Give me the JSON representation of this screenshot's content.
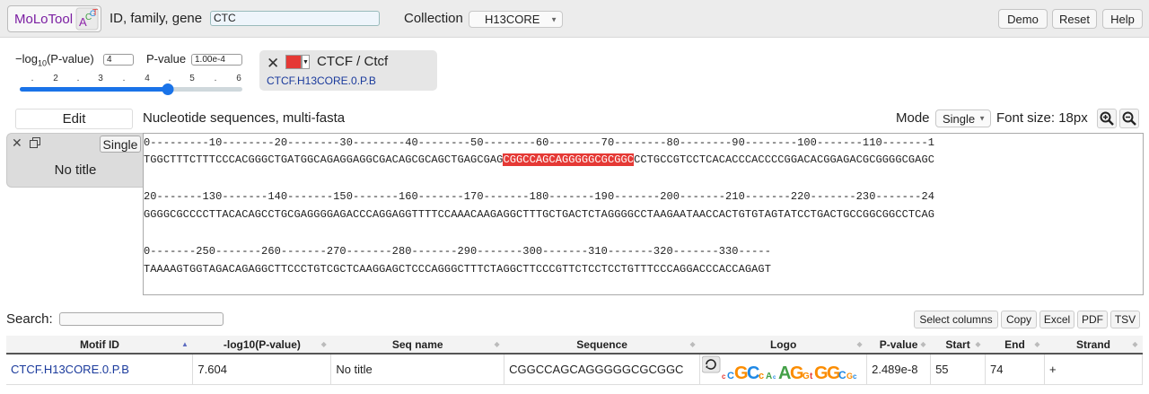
{
  "header": {
    "brand": "MoLoTool",
    "gene_label": "ID, family, gene",
    "gene_value": "CTC",
    "collection_label": "Collection",
    "collection_value": "H13CORE",
    "buttons": [
      "Demo",
      "Reset",
      "Help"
    ]
  },
  "threshold": {
    "log_label": "−log",
    "log_sub": "10",
    "log_suffix": "(P-value)",
    "log_value": "4",
    "pvalue_label": "P-value",
    "pvalue_value": "1.00e-4",
    "ticks": [
      ".",
      "2",
      ".",
      "3",
      ".",
      "4",
      ".",
      "5",
      ".",
      "6"
    ],
    "slider_level": 4,
    "slider_min": 0,
    "slider_max": 6
  },
  "motif_card": {
    "name": "CTCF / Ctcf",
    "id": "CTCF.H13CORE.0.P.B",
    "color": "#e53935"
  },
  "sequence_toolbar": {
    "edit": "Edit",
    "label": "Nucleotide sequences, multi-fasta",
    "mode_label": "Mode",
    "mode_value": "Single",
    "font_size_label": "Font size: 18px"
  },
  "sequence": {
    "single_button": "Single",
    "title": "No title",
    "ruler_1": "0---------10--------20--------30--------40--------50--------60--------70--------80--------90--------100-------110-------1",
    "seq_1_pre": "TGGCTTTCTTTCCCACGGGCTGATGGCAGAGGAGGCGACAGCGCAGCTGAGCGAG",
    "seq_1_hit": "CGGCCAGCAGGGGGCGCGGC",
    "seq_1_post": "CCTGCCGTCCTCACACCCACCCCGGACACGGAGACGCGGGGCGAGC",
    "ruler_2": "20-------130-------140-------150-------160-------170-------180-------190-------200-------210-------220-------230-------24",
    "seq_2": "GGGGCGCCCCTTACACAGCCTGCGAGGGGAGACCCAGGAGGTTTTCCAAACAAGAGGCTTTGCTGACTCTAGGGGCCTAAGAATAACCACTGTGTAGTATCCTGACTGCCGGCGGCCTCAG",
    "ruler_3": "0-------250-------260-------270-------280-------290-------300-------310-------320-------330-----",
    "seq_3": "TAAAAGTGGTAGACAGAGGCTTCCCTGTCGCTCAAGGAGCTCCCAGGGCTTTCTAGGCTTCCCGTTCTCCTCCTGTTTCCCAGGACCCACCAGAGT"
  },
  "table_tools": {
    "search_label": "Search:",
    "buttons": [
      "Select columns",
      "Copy",
      "Excel",
      "PDF",
      "TSV"
    ]
  },
  "results": {
    "columns": [
      "Motif ID",
      "-log10(P-value)",
      "Seq name",
      "Sequence",
      "Logo",
      "P-value",
      "Start",
      "End",
      "Strand"
    ],
    "rows": [
      {
        "motif_id": "CTCF.H13CORE.0.P.B",
        "log_p": "7.604",
        "seq_name": "No title",
        "sequence": "CGGCCAGCAGGGGGCGCGGC",
        "p_value": "2.489e-8",
        "start": "55",
        "end": "74",
        "strand": "+"
      }
    ]
  },
  "icons": {
    "close": "close-icon",
    "copy": "copy-icon",
    "zoom_in": "zoom-in-icon",
    "zoom_out": "zoom-out-icon",
    "revcomp": "reverse-complement-icon"
  }
}
